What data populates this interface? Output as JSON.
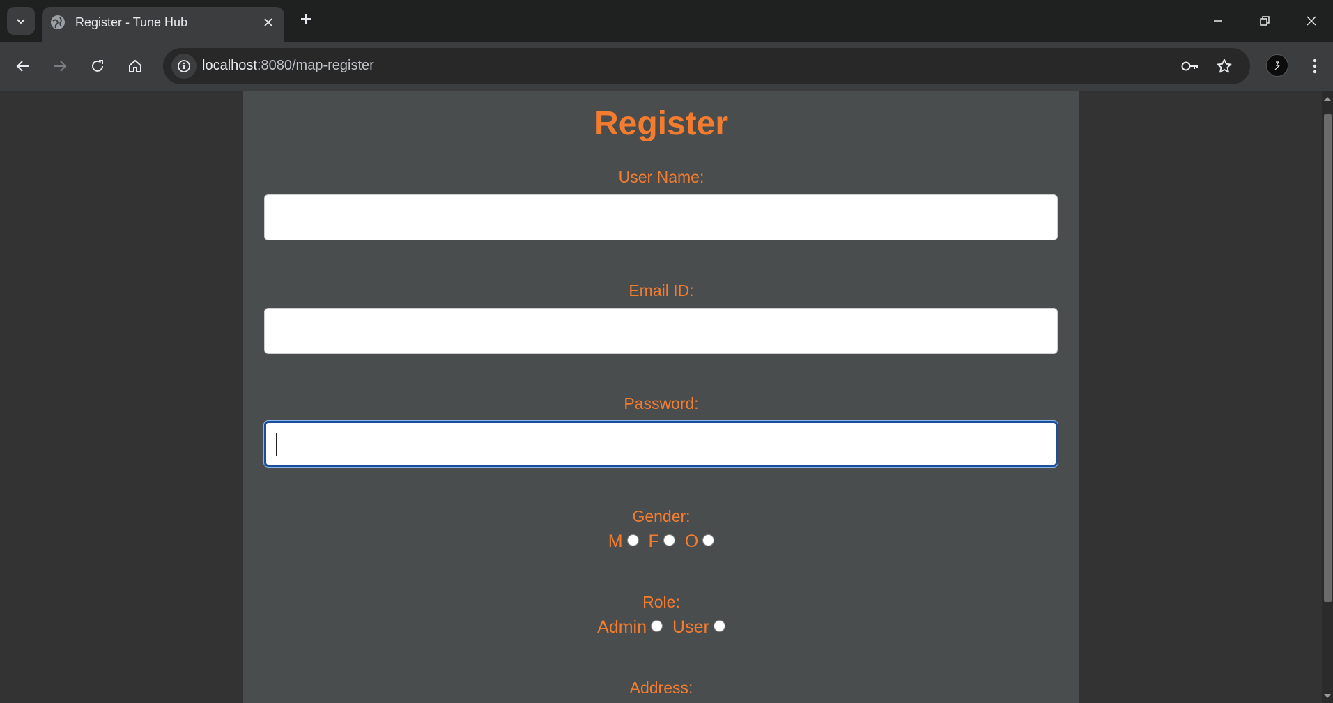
{
  "browser": {
    "tab_title": "Register - Tune Hub",
    "url_host": "localhost",
    "url_path": ":8080/map-register",
    "icons": [
      "tab-search-icon",
      "globe-icon",
      "close-icon",
      "plus-icon",
      "minimize-icon",
      "restore-icon",
      "back-icon",
      "forward-icon",
      "reload-icon",
      "home-icon",
      "info-icon",
      "key-icon",
      "star-icon",
      "profile-icon",
      "kebab-menu-icon"
    ]
  },
  "form": {
    "heading": "Register",
    "username_label": "User Name:",
    "email_label": "Email ID:",
    "password_label": "Password:",
    "gender_label": "Gender:",
    "gender_options": [
      "M",
      "F",
      "O"
    ],
    "role_label": "Role:",
    "role_options": [
      "Admin",
      "User"
    ],
    "address_label": "Address:"
  },
  "colors": {
    "accent": "#f47c2f",
    "panel": "#4a4d4e",
    "page": "#333333",
    "focus": "#1a4f9e"
  }
}
